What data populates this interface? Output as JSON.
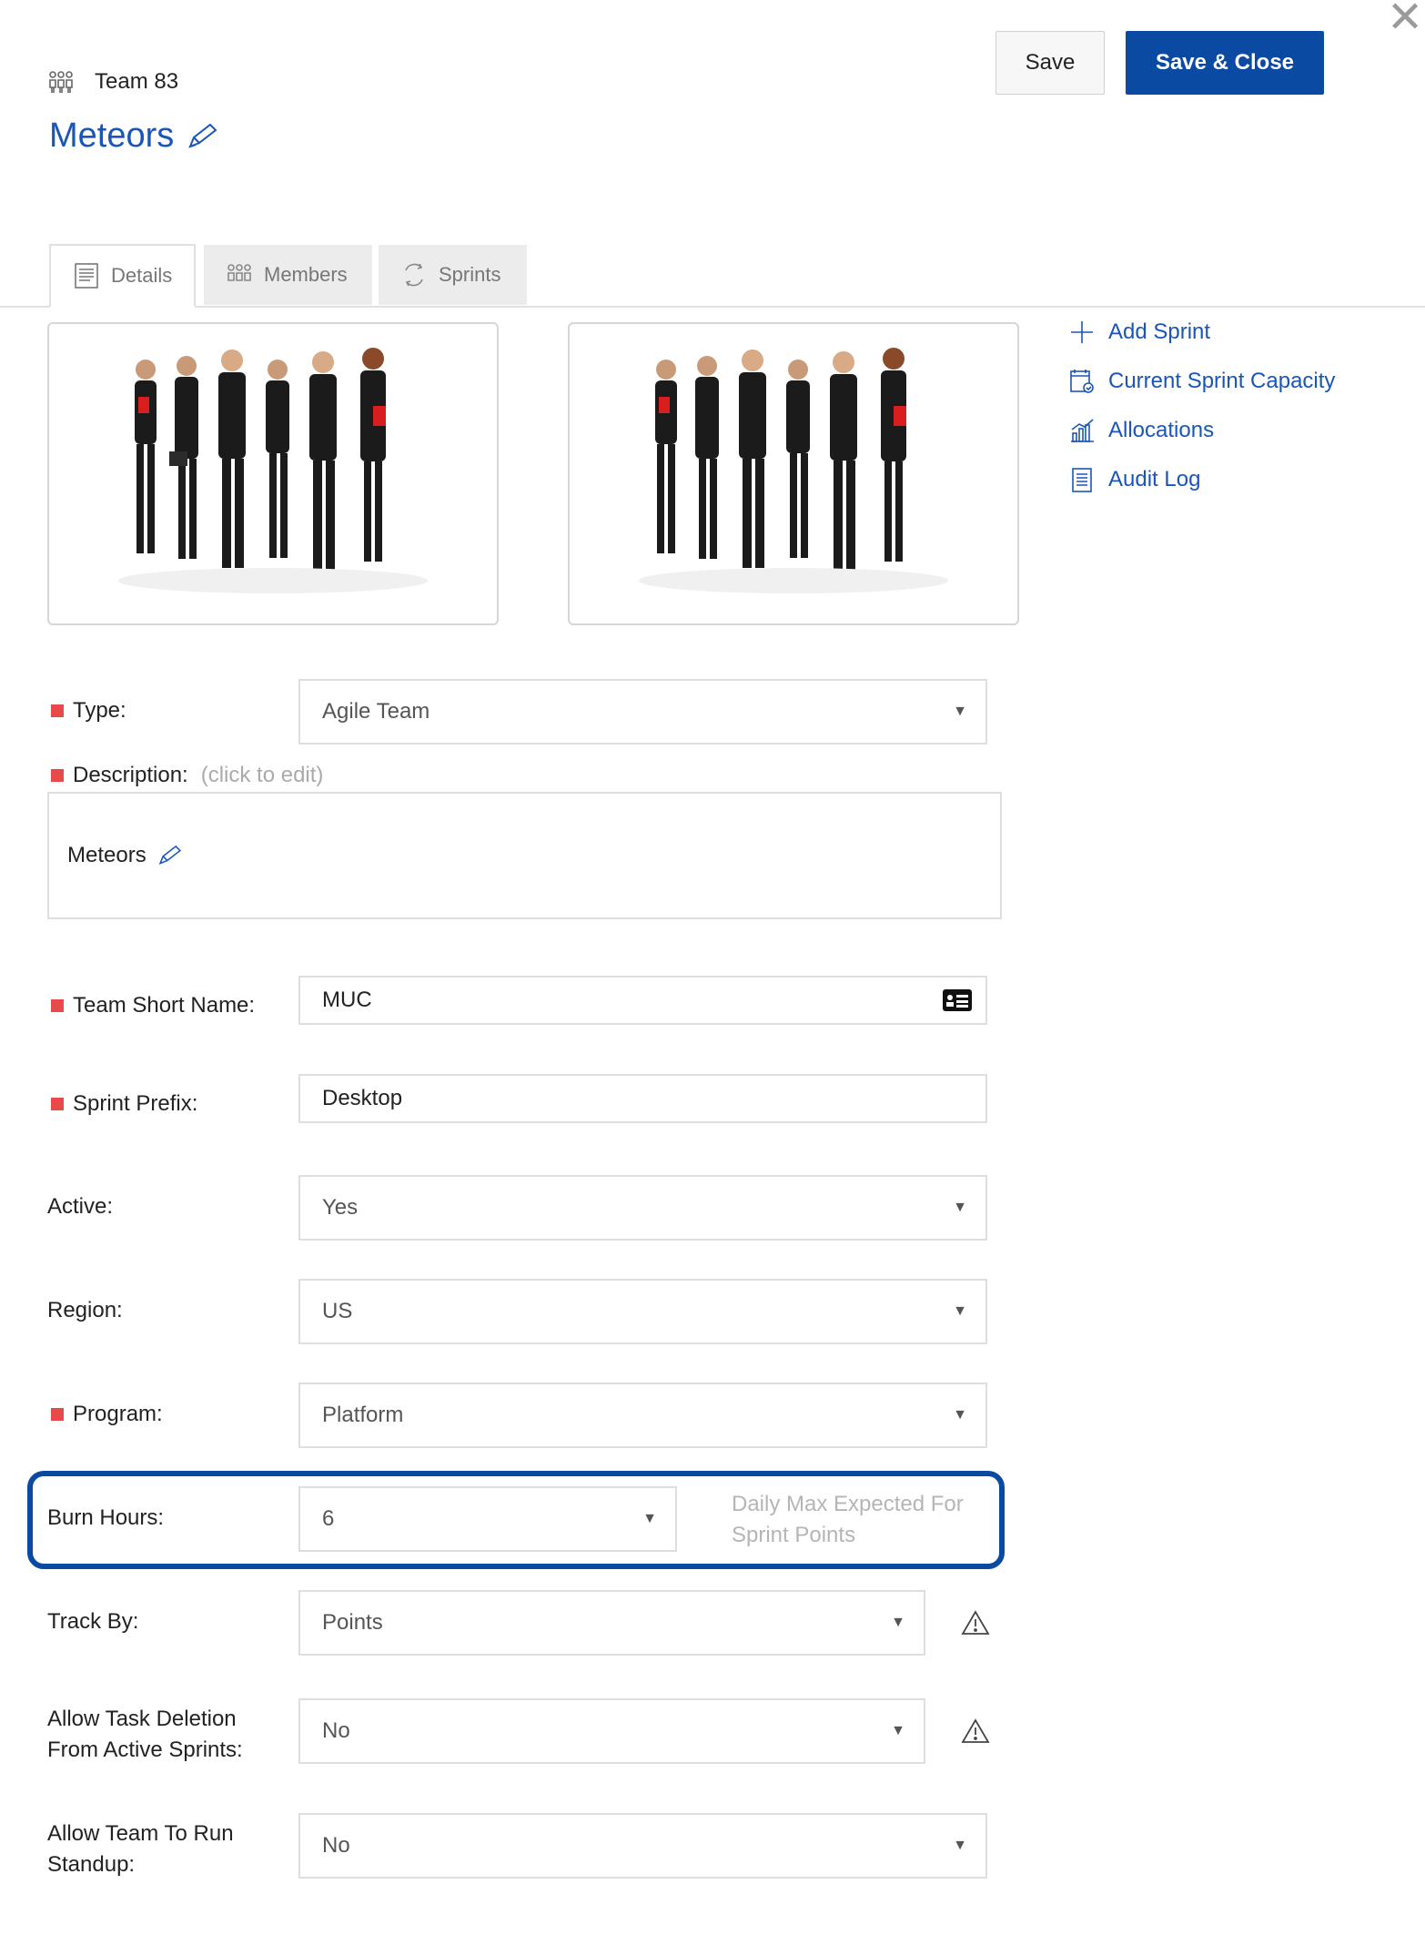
{
  "header": {
    "close_icon": "close-icon",
    "team_label": "Team 83",
    "title": "Meteors",
    "save_label": "Save",
    "save_close_label": "Save & Close"
  },
  "tabs": [
    {
      "label": "Details",
      "icon": "document-icon",
      "active": true
    },
    {
      "label": "Members",
      "icon": "team-icon",
      "active": false
    },
    {
      "label": "Sprints",
      "icon": "sprint-cycle-icon",
      "active": false
    }
  ],
  "side_links": [
    {
      "label": "Add Sprint",
      "icon": "plus-icon"
    },
    {
      "label": "Current Sprint Capacity",
      "icon": "calendar-check-icon"
    },
    {
      "label": "Allocations",
      "icon": "bar-chart-icon"
    },
    {
      "label": "Audit Log",
      "icon": "log-icon"
    }
  ],
  "form": {
    "type": {
      "label": "Type:",
      "value": "Agile Team",
      "required": true
    },
    "description": {
      "label": "Description:",
      "hint": "(click to edit)",
      "value": "Meteors",
      "required": true
    },
    "short_name": {
      "label": "Team Short Name:",
      "value": "MUC",
      "required": true
    },
    "sprint_prefix": {
      "label": "Sprint Prefix:",
      "value": "Desktop",
      "required": true
    },
    "active": {
      "label": "Active:",
      "value": "Yes"
    },
    "region": {
      "label": "Region:",
      "value": "US"
    },
    "program": {
      "label": "Program:",
      "value": "Platform",
      "required": true
    },
    "burn_hours": {
      "label": "Burn Hours:",
      "value": "6",
      "hint": "Daily Max Expected For Sprint Points"
    },
    "track_by": {
      "label": "Track By:",
      "value": "Points"
    },
    "allow_task_deletion": {
      "label_line1": "Allow Task Deletion",
      "label_line2": "From Active Sprints:",
      "value": "No"
    },
    "allow_standup": {
      "label_line1": "Allow Team To Run",
      "label_line2": "Standup:",
      "value": "No"
    }
  },
  "colors": {
    "accent": "#0a4aa3",
    "link": "#1a56b8",
    "required": "#e84a4a"
  }
}
